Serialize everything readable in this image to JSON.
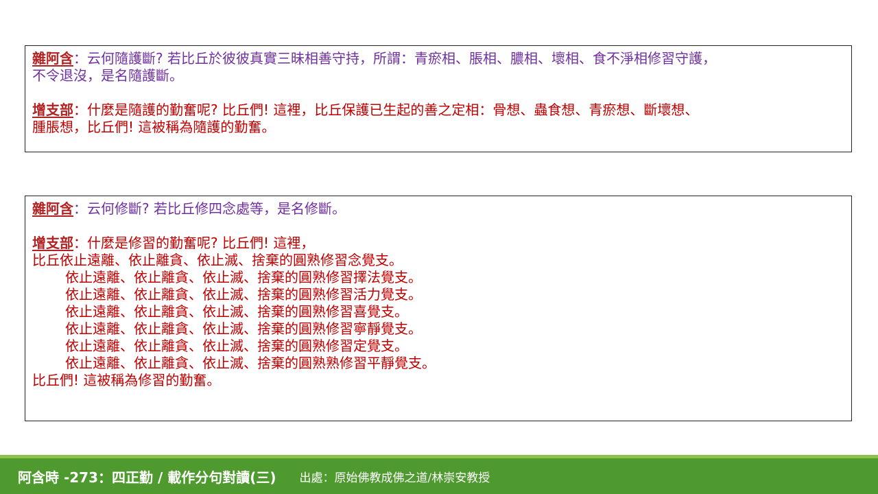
{
  "box1": {
    "sa_label": "雜阿含",
    "sa_text": "：云何隨護斷? 若比丘於彼彼真實三昧相善守持，所謂：青瘀相、脹相、膿相、壞相、食不淨相修習守護，",
    "sa_text2": "不令退沒，是名隨護斷。",
    "an_label": "增支部",
    "an_text": "：什麼是隨護的勤奮呢? 比丘們! 這裡，比丘保護已生起的善之定相：骨想、蟲食想、青瘀想、斷壞想、",
    "an_text2": "腫脹想，比丘們! 這被稱為隨護的勤奮。"
  },
  "box2": {
    "sa_label": "雜阿含",
    "sa_text": "：云何修斷? 若比丘修四念處等，是名修斷。",
    "an_label": "增支部",
    "an_text": "：什麼是修習的勤奮呢? 比丘們! 這裡，",
    "lines": [
      "比丘依止遠離、依止離貪、依止滅、捨棄的圓熟修習念覺支。",
      "依止遠離、依止離貪、依止滅、捨棄的圓熟修習擇法覺支。",
      "依止遠離、依止離貪、依止滅、捨棄的圓熟修習活力覺支。",
      "依止遠離、依止離貪、依止滅、捨棄的圓熟修習喜覺支。",
      "依止遠離、依止離貪、依止滅、捨棄的圓熟修習寧靜覺支。",
      "依止遠離、依止離貪、依止滅、捨棄的圓熟修習定覺支。",
      "依止遠離、依止離貪、依止滅、捨棄的圓熟熟修習平靜覺支。"
    ],
    "closing": "比丘們! 這被稱為修習的勤奮。"
  },
  "footer": {
    "title": "阿含時 -273：四正勤 / 載作分句對讀(三)",
    "source": "出處：原始佛教成佛之道/林崇安教授"
  },
  "colors": {
    "label": "#b22222",
    "sa_text": "#7030a0",
    "an_text": "#c00000",
    "footer_bar": "#4e9a2e",
    "footer_strip": "#8bc34a"
  }
}
